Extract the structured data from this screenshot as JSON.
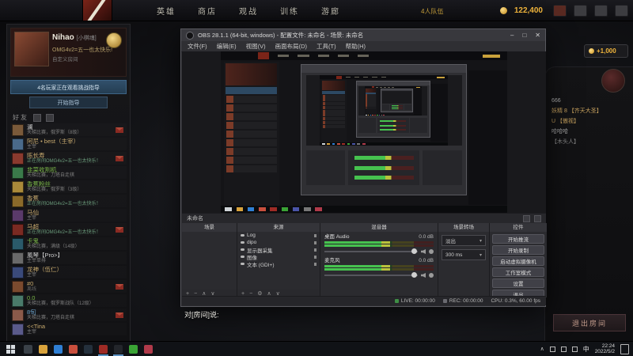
{
  "icons": {
    "plus": "+",
    "minus": "−",
    "up": "∧",
    "down": "∨",
    "gear": "⚙",
    "dropdown": "▾",
    "caret": "∧",
    "win_min": "–",
    "win_max": "□",
    "win_close": "✕"
  },
  "top_nav": {
    "menu": [
      "英雄",
      "商店",
      "观战",
      "训练",
      "游廊"
    ],
    "party_label": "4人队伍",
    "currency": "122,400",
    "icons": [
      {
        "name": "armory-icon",
        "color": "#5a2a22"
      },
      {
        "name": "store-icon",
        "color": "#3c3c40"
      },
      {
        "name": "watch-icon",
        "color": "#3c3c40"
      },
      {
        "name": "notifications-icon",
        "color": "#3c3c40"
      }
    ]
  },
  "profile": {
    "name": "Nihao",
    "tag": "[小棋魂]",
    "status_line": "OMG4v2=五一也太快乐!",
    "sub_line": "自定义房间",
    "banner_text": "4名玩家正在观看挑战指导",
    "coach_button": "开始指导"
  },
  "friends": {
    "header": "好友",
    "items": [
      {
        "name": "澜",
        "status": "天梯比赛，俄罗斯（8级）",
        "name_color": "#cfcfcf",
        "status_color": "#7d7d7d",
        "avatar": "#7a5a3a",
        "mail": true
      },
      {
        "name": "阿尼 • best（主宰）",
        "status": "主宰",
        "name_color": "#c8aa6e",
        "status_color": "#7d7d7d",
        "avatar": "#4a6a8a",
        "mail": false
      },
      {
        "name": "陈长寿",
        "status": "正在房间OMG4v2=五一也太快乐！",
        "name_color": "#c8aa6e",
        "status_color": "#6a9a7a",
        "avatar": "#8a3a2e",
        "mail": true
      },
      {
        "name": "韭菜收割机",
        "status": "天梯比赛，刀塔自走棋",
        "name_color": "#7ab648",
        "status_color": "#7d7d7d",
        "avatar": "#3a7a4a",
        "mail": false
      },
      {
        "name": "香蕉粉丝",
        "status": "天梯比赛，俄罗斯（3级）",
        "name_color": "#7ab648",
        "status_color": "#7d7d7d",
        "avatar": "#aa8a3a",
        "mail": false
      },
      {
        "name": "香蕉",
        "status": "正在房间OMG4v2=五一也太快乐！",
        "name_color": "#c8aa6e",
        "status_color": "#6a9a7a",
        "avatar": "#8a6a2a",
        "mail": false
      },
      {
        "name": "马仙",
        "status": "主宰",
        "name_color": "#c8aa6e",
        "status_color": "#7d7d7d",
        "avatar": "#5a3a6a",
        "mail": false
      },
      {
        "name": "马超",
        "status": "正在房间OMG4v2=五一也太快乐！",
        "name_color": "#c8aa6e",
        "status_color": "#6a9a7a",
        "avatar": "#7a2a22",
        "mail": true
      },
      {
        "name": "卡鬼",
        "status": "天梯比赛，满级（14级）",
        "name_color": "#7ab648",
        "status_color": "#7d7d7d",
        "avatar": "#2a5a6a",
        "mail": false
      },
      {
        "name": "風琴【Pro>】",
        "status": "主宰单排",
        "name_color": "#cfcfcf",
        "status_color": "#7d7d7d",
        "avatar": "#6a6a6a",
        "mail": false
      },
      {
        "name": "龙神（伍仁）",
        "status": "主宰",
        "name_color": "#c8aa6e",
        "status_color": "#7d7d7d",
        "avatar": "#3a4a7a",
        "mail": false
      },
      {
        "name": "#0",
        "status": "离线",
        "name_color": "#c8aa6e",
        "status_color": "#666666",
        "avatar": "#7a4a2e",
        "mail": true
      },
      {
        "name": "0.0",
        "status": "天梯比赛，俄罗斯战队（12级）",
        "name_color": "#7ab648",
        "status_color": "#7d7d7d",
        "avatar": "#4a7a6a",
        "mail": false
      },
      {
        "name": "8旬",
        "status": "天梯比赛，刀塔自走棋",
        "name_color": "#6aa0c8",
        "status_color": "#7d7d7d",
        "avatar": "#8a5a4a",
        "mail": true
      },
      {
        "name": "<<Tina",
        "status": "主宰",
        "name_color": "#c8aa6e",
        "status_color": "#7d7d7d",
        "avatar": "#5a5a8a",
        "mail": false
      }
    ]
  },
  "obs": {
    "title": "OBS 28.1.1 (64-bit, windows) - 配置文件: 未命名 - 场景: 未命名",
    "menu": [
      "文件(F)",
      "编辑(E)",
      "视图(V)",
      "画面布局(D)",
      "工具(T)",
      "帮助(H)"
    ],
    "dock_label": "未命名",
    "scenes_header": "场景",
    "sources_header": "来源",
    "sources": [
      "Log",
      "dipo",
      "显示器采集",
      "图像",
      "文本 (GDI+)"
    ],
    "mixer_header": "混音器",
    "mixer_channels": [
      {
        "label": "桌面 Audio",
        "db": "0.0 dB"
      },
      {
        "label": "麦克风",
        "db": "0.0 dB"
      }
    ],
    "transitions_header": "场景转场",
    "transition_value": "淡出",
    "transition_duration": "300 ms",
    "controls_header": "控件",
    "control_buttons": [
      "开始推流",
      "开始录制",
      "启动虚拟摄像机",
      "工作室模式",
      "设置",
      "退出"
    ],
    "status": {
      "live": "LIVE: 00:00:00",
      "rec": "REC: 00:00:00",
      "cpu": "CPU: 0.3%, 60.00 fps"
    }
  },
  "right_panel": {
    "messages": [
      {
        "text": "666",
        "color": "#b0b0b0"
      },
      {
        "text": "妖精 8 【齐天大圣】",
        "color": "#c8a25e"
      },
      {
        "text": "U 【傲视】",
        "color": "#c8a25e"
      },
      {
        "text": "哈哈哈",
        "color": "#a8a8a8"
      },
      {
        "text": "【木头人】",
        "color": "#8a8a8a"
      }
    ],
    "exit_button": "退出房间",
    "plus_button": "+1,000"
  },
  "chat_prompt": "对[房间]说:",
  "taskbar": {
    "apps": [
      {
        "name": "search-icon",
        "color": "#3a4148",
        "active": false
      },
      {
        "name": "file-explorer-icon",
        "color": "#d9a33c",
        "active": false
      },
      {
        "name": "edge-browser-icon",
        "color": "#2f7fd4",
        "active": false
      },
      {
        "name": "chrome-icon",
        "color": "#c94f3d",
        "active": false
      },
      {
        "name": "steam-icon",
        "color": "#24303c",
        "active": false
      },
      {
        "name": "dota2-icon",
        "color": "#9e2b25",
        "active": true
      },
      {
        "name": "obs-icon",
        "color": "#23262b",
        "active": true
      },
      {
        "name": "wechat-icon",
        "color": "#3aa335",
        "active": false
      },
      {
        "name": "netease-music-icon",
        "color": "#b03a4a",
        "active": false
      }
    ],
    "ime": "中",
    "time": "22:24",
    "date": "2022/5/2"
  }
}
